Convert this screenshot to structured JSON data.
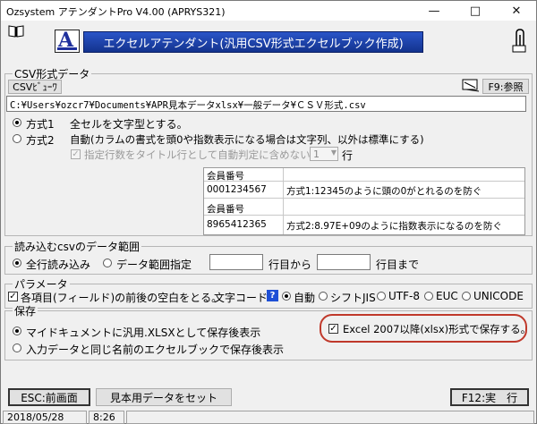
{
  "window": {
    "title": "Ozsystem アテンダントPro V4.00 (APRYS321)"
  },
  "banner": {
    "title": "エクセルアテンダント(汎用CSV形式エクセルブック作成)"
  },
  "csv": {
    "group_title": "CSV形式データ",
    "viewer_button": "CSVﾋﾞｭｰﾜ",
    "browse_button": "F9:参照",
    "path_value": "C:¥Users¥ozcr7¥Documents¥APR見本データxlsx¥一般データ¥ＣＳＶ形式.csv",
    "mode1_label": "方式1",
    "mode1_desc": "全セルを文字型とする。",
    "mode2_label": "方式2",
    "mode2_desc": "自動(カラムの書式を頭0や指数表示になる場合は文字列、以外は標準にする)",
    "title_rows_label": "指定行数をタイトル行として自動判定に含めない",
    "title_rows_value": "1",
    "title_rows_unit": "行",
    "preview": {
      "table1": {
        "header": "会員番号",
        "value": "0001234567",
        "note": "方式1:12345のように頭の0がとれるのを防ぐ"
      },
      "table2": {
        "header": "会員番号",
        "value": "8965412365",
        "note": "方式2:8.97E+09のように指数表示になるのを防ぐ"
      }
    }
  },
  "range": {
    "group_title": "読み込むcsvのデータ範囲",
    "all_rows_label": "全行読み込み",
    "specify_label": "データ範囲指定",
    "from_value": "",
    "from_suffix": "行目から",
    "to_value": "",
    "to_suffix": "行目まで"
  },
  "params": {
    "group_title": "パラメータ",
    "trim_label": "各項目(フィールド)の前後の空白をとる。",
    "trim_checked": true,
    "encoding_label": "文字コード",
    "help_glyph": "?",
    "encodings": [
      {
        "label": "自動",
        "selected": true
      },
      {
        "label": "シフトJIS",
        "selected": false
      },
      {
        "label": "UTF-8",
        "selected": false
      },
      {
        "label": "EUC",
        "selected": false
      },
      {
        "label": "UNICODE",
        "selected": false
      }
    ]
  },
  "save": {
    "group_title": "保存",
    "opt1_label": "マイドキュメントに汎用.XLSXとして保存後表示",
    "opt2_label": "入力データと同じ名前のエクセルブックで保存後表示",
    "xlsx_label": "Excel 2007以降(xlsx)形式で保存する。",
    "xlsx_checked": true,
    "highlight_color": "#c0392b"
  },
  "buttons": {
    "esc": "ESC:前画面",
    "sample": "見本用データをセット",
    "run": "F12:実　行"
  },
  "status": {
    "date": "2018/05/28",
    "time": "8:26"
  },
  "icons": [
    "book-icon",
    "paperclip-icon",
    "minimize-icon",
    "maximize-icon",
    "close-icon",
    "browse-icon",
    "dropdown-icon",
    "help-icon"
  ]
}
